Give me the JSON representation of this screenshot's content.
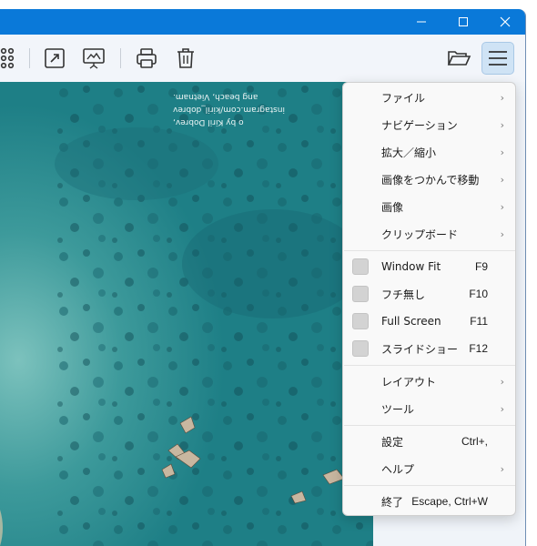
{
  "titlebar": {
    "icons": [
      "minimize-icon",
      "maximize-icon",
      "close-icon"
    ]
  },
  "toolbar": {
    "icons": [
      "grid-icon",
      "open-external-icon",
      "slideshow-icon",
      "print-icon",
      "trash-icon",
      "folder-open-icon",
      "hamburger-menu-icon"
    ]
  },
  "image": {
    "caption_line1": "o by Kiril Dobrev, instagram.com/kiril_dobrev",
    "caption_line2": "ang beach, Vietnam."
  },
  "menu": {
    "items": [
      {
        "label": "ファイル",
        "has_submenu": true
      },
      {
        "label": "ナビゲーション",
        "has_submenu": true
      },
      {
        "label": "拡大／縮小",
        "has_submenu": true
      },
      {
        "label": "画像をつかんで移動",
        "has_submenu": true
      },
      {
        "label": "画像",
        "has_submenu": true
      },
      {
        "label": "クリップボード",
        "has_submenu": true
      }
    ],
    "toggles": [
      {
        "label": "Window Fit",
        "shortcut": "F9"
      },
      {
        "label": "フチ無し",
        "shortcut": "F10"
      },
      {
        "label": "Full Screen",
        "shortcut": "F11"
      },
      {
        "label": "スライドショー",
        "shortcut": "F12"
      }
    ],
    "group3": [
      {
        "label": "レイアウト",
        "has_submenu": true
      },
      {
        "label": "ツール",
        "has_submenu": true
      }
    ],
    "group4": [
      {
        "label": "設定",
        "shortcut": "Ctrl+,"
      },
      {
        "label": "ヘルプ",
        "has_submenu": true
      }
    ],
    "exit": {
      "label": "終了",
      "shortcut": "Escape, Ctrl+W"
    },
    "arrow_glyph": "›"
  },
  "colors": {
    "titlebar": "#0a79d9",
    "water": "#1e7f86",
    "menu_bg": "#f9f9f9",
    "active_button": "#cfe3f5"
  }
}
